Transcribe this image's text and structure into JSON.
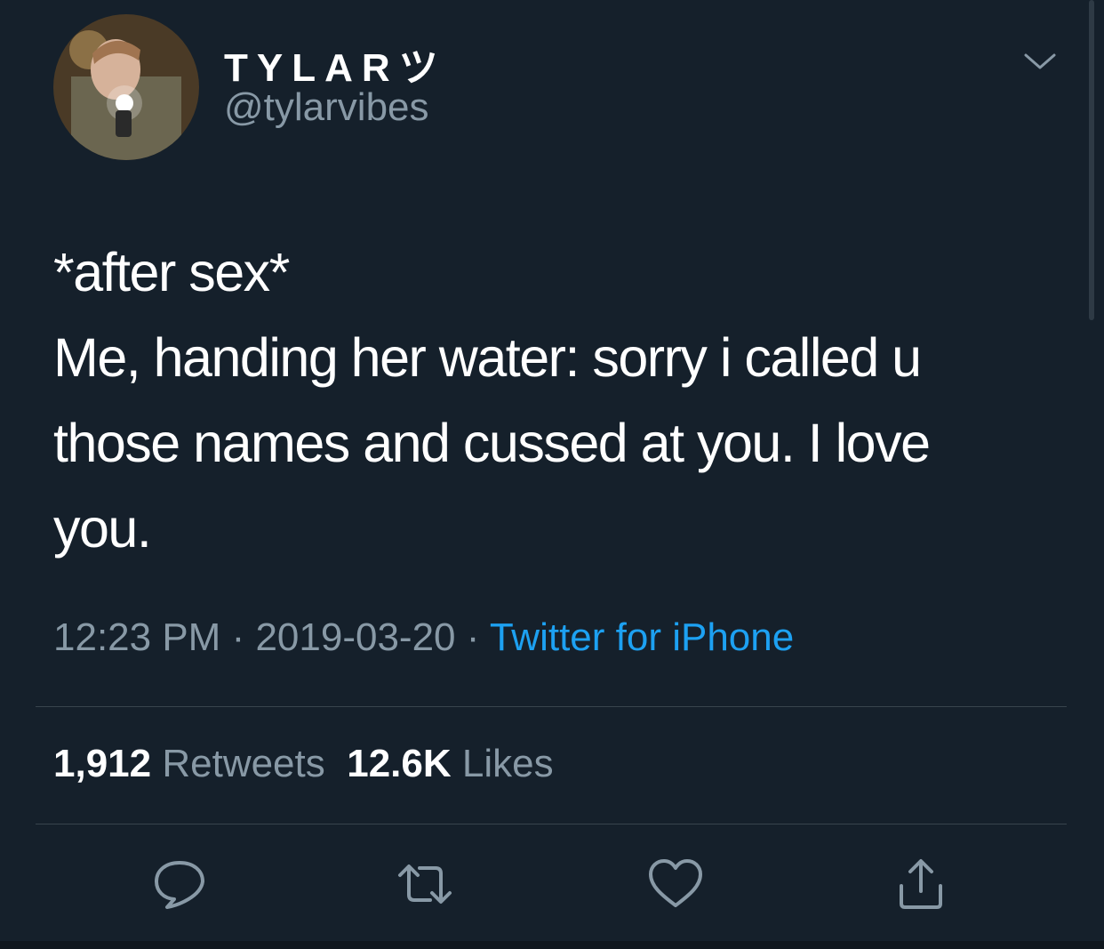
{
  "author": {
    "display_name": "TYLARツ",
    "handle": "@tylarvibes"
  },
  "tweet": {
    "lines": [
      "*after sex*",
      "Me, handing her water: sorry i called u",
      "those names and cussed at you. I love",
      "you."
    ]
  },
  "meta": {
    "time": "12:23 PM",
    "separator": " · ",
    "date": "2019-03-20",
    "source": "Twitter for iPhone"
  },
  "stats": {
    "retweets_count": "1,912",
    "retweets_label": "Retweets",
    "likes_count": "12.6K",
    "likes_label": "Likes"
  },
  "icons": {
    "caret": "chevron-down-icon",
    "reply": "reply-icon",
    "retweet": "retweet-icon",
    "like": "heart-icon",
    "share": "share-icon"
  },
  "colors": {
    "background": "#15202b",
    "text": "#ffffff",
    "secondary": "#8899a6",
    "link": "#1da1f2",
    "divider": "#38444d"
  }
}
